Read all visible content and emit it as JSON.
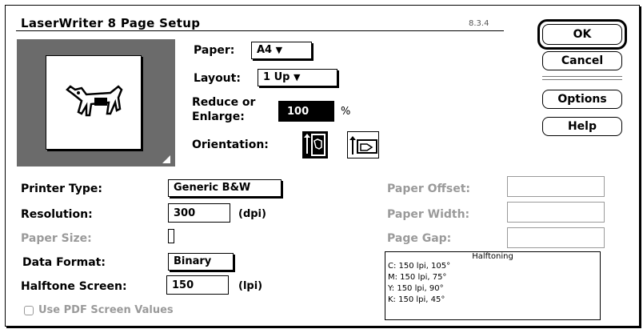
{
  "window": {
    "title": "LaserWriter 8 Page Setup",
    "version": "8.3.4"
  },
  "buttons": {
    "ok": "OK",
    "cancel": "Cancel",
    "options": "Options",
    "help": "Help"
  },
  "paper": {
    "label": "Paper:",
    "value": "A4"
  },
  "layout": {
    "label": "Layout:",
    "value": "1 Up"
  },
  "reduce": {
    "label_line1": "Reduce or",
    "label_line2": "Enlarge:",
    "value": "100",
    "unit": "%"
  },
  "orientation": {
    "label": "Orientation:",
    "options": [
      "portrait",
      "landscape"
    ],
    "selected": "portrait"
  },
  "printer_type": {
    "label": "Printer Type:",
    "value": "Generic B&W"
  },
  "resolution": {
    "label": "Resolution:",
    "value": "300",
    "unit": "(dpi)"
  },
  "paper_size": {
    "label": "Paper Size:"
  },
  "data_format": {
    "label": "Data Format:",
    "value": "Binary"
  },
  "halftone_screen": {
    "label": "Halftone Screen:",
    "value": "150",
    "unit": "(lpi)"
  },
  "pdf_screen": {
    "label": "Use PDF Screen Values",
    "checked": false
  },
  "paper_offset": {
    "label": "Paper Offset:"
  },
  "paper_width": {
    "label": "Paper Width:"
  },
  "page_gap": {
    "label": "Page Gap:"
  },
  "halftoning": {
    "title": "Halftoning",
    "lines": [
      "C: 150 lpi, 105°",
      "M: 150 lpi, 75°",
      "Y: 150 lpi, 90°",
      "K: 150 lpi, 45°"
    ]
  },
  "icons": {
    "dropdown": "triangle-down-icon",
    "preview": "dogcow-icon"
  }
}
